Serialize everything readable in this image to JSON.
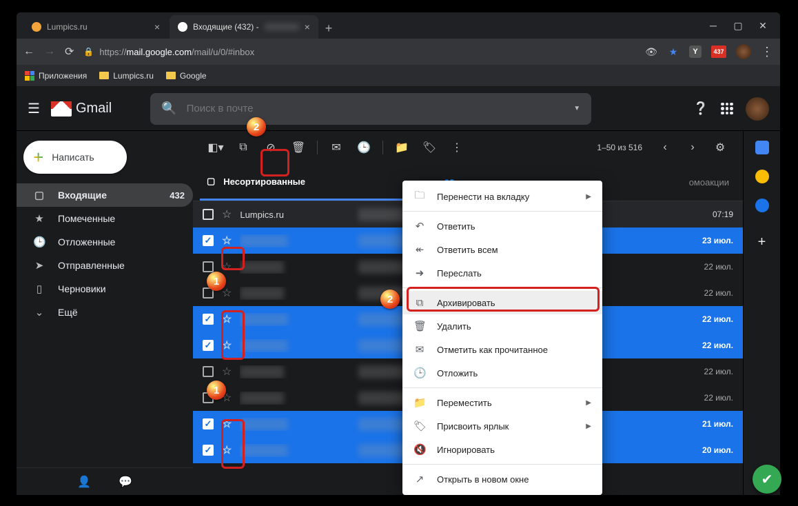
{
  "browser": {
    "tabs": [
      {
        "title": "Lumpics.ru",
        "active": false
      },
      {
        "title": "Входящие (432) -",
        "active": true
      }
    ],
    "url_prefix": "https://",
    "url_host": "mail.google.com",
    "url_path": "/mail/u/0/#inbox",
    "bookmarks": {
      "apps": "Приложения",
      "b1": "Lumpics.ru",
      "b2": "Google"
    },
    "ext_badge": "437",
    "ext_y": "Y"
  },
  "gmail": {
    "brand": "Gmail",
    "search_placeholder": "Поиск в почте",
    "compose": "Написать",
    "nav": {
      "inbox": "Входящие",
      "inbox_count": "432",
      "starred": "Помеченные",
      "snoozed": "Отложенные",
      "sent": "Отправленные",
      "drafts": "Черновики",
      "more": "Ещё"
    },
    "pagination": "1–50 из 516",
    "tabs": {
      "primary": "Несортированные",
      "social": "",
      "promo": "омоакции"
    },
    "rows": [
      {
        "sel": false,
        "read": false,
        "sender": "Lumpics.ru",
        "date": "07:19",
        "senderBlur": false
      },
      {
        "sel": true,
        "read": false,
        "sender": "blurred",
        "date": "23 июл.",
        "senderBlur": true
      },
      {
        "sel": false,
        "read": true,
        "sender": "blurred",
        "date": "22 июл.",
        "senderBlur": true
      },
      {
        "sel": false,
        "read": true,
        "sender": "blurred",
        "date": "22 июл.",
        "senderBlur": true
      },
      {
        "sel": true,
        "read": false,
        "sender": "blurred",
        "date": "22 июл.",
        "senderBlur": true
      },
      {
        "sel": true,
        "read": false,
        "sender": "blurred",
        "date": "22 июл.",
        "senderBlur": true
      },
      {
        "sel": false,
        "read": true,
        "sender": "blurred",
        "date": "22 июл.",
        "senderBlur": true
      },
      {
        "sel": false,
        "read": true,
        "sender": "blurred",
        "date": "22 июл.",
        "senderBlur": true
      },
      {
        "sel": true,
        "read": false,
        "sender": "blurred",
        "date": "21 июл.",
        "senderBlur": true
      },
      {
        "sel": true,
        "read": false,
        "sender": "blurred",
        "date": "20 июл.",
        "senderBlur": true
      }
    ]
  },
  "ctx": {
    "move_tab": "Перенести на вкладку",
    "reply": "Ответить",
    "reply_all": "Ответить всем",
    "forward": "Переслать",
    "archive": "Архивировать",
    "delete": "Удалить",
    "mark_read": "Отметить как прочитанное",
    "snooze": "Отложить",
    "move_to": "Переместить",
    "label": "Присвоить ярлык",
    "mute": "Игнорировать",
    "open_new": "Открыть в новом окне"
  },
  "annotations": {
    "one": "1",
    "two": "2"
  }
}
